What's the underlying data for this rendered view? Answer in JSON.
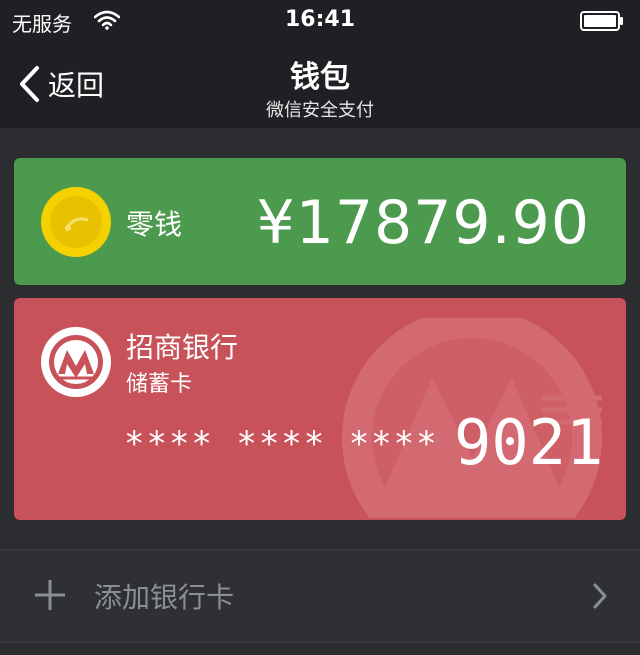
{
  "status_bar": {
    "carrier": "无服务",
    "time": "16:41"
  },
  "nav": {
    "back_label": "返回",
    "title": "钱包",
    "subtitle": "微信安全支付"
  },
  "change_card": {
    "label": "零钱",
    "amount": "¥17879.90",
    "color": "#4c9a4e"
  },
  "bank_card": {
    "bank_name": "招商银行",
    "card_type": "储蓄卡",
    "masked_number": "**** **** ****",
    "last4": "9021",
    "color": "#c8525a"
  },
  "add_card": {
    "label": "添加银行卡"
  }
}
